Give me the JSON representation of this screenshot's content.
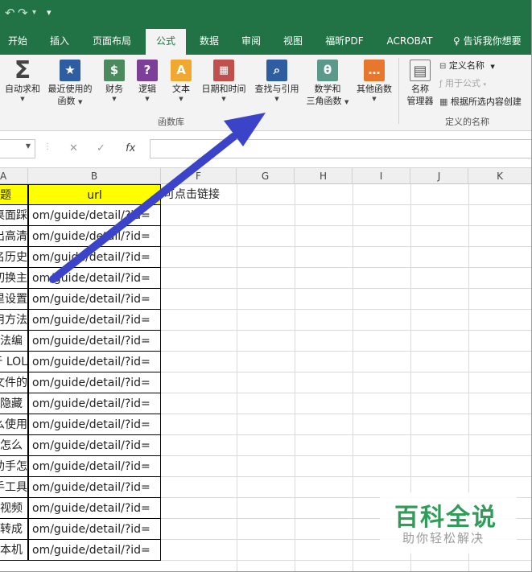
{
  "colors": {
    "excel_green": "#217346",
    "header_fill": "#ffff00",
    "arrow": "#3b44c8",
    "watermark_green": "#2f9d58",
    "watermark_gray": "#9a9a9a"
  },
  "qat": {
    "redo_glyph": "↷",
    "customize_glyph": "▾"
  },
  "tabs": [
    {
      "label": "开始"
    },
    {
      "label": "插入"
    },
    {
      "label": "页面布局"
    },
    {
      "label": "公式",
      "active": true
    },
    {
      "label": "数据"
    },
    {
      "label": "审阅"
    },
    {
      "label": "视图"
    },
    {
      "label": "福昕PDF"
    },
    {
      "label": "ACROBAT"
    }
  ],
  "tell_me": {
    "icon": "lightbulb-icon",
    "text": "告诉我你想要"
  },
  "ribbon": {
    "function_library": {
      "group_label": "函数库",
      "buttons": [
        {
          "label": "自动求和",
          "label2": "",
          "icon": "sigma-icon",
          "glyph": "Σ",
          "color": "#444444"
        },
        {
          "label": "最近使用的",
          "label2": "函数",
          "icon": "star-book-icon",
          "glyph": "★",
          "color": "#2e5e9f"
        },
        {
          "label": "财务",
          "label2": "",
          "icon": "finance-book-icon",
          "glyph": "$",
          "color": "#4b8a5c"
        },
        {
          "label": "逻辑",
          "label2": "",
          "icon": "logic-book-icon",
          "glyph": "?",
          "color": "#7d3f98"
        },
        {
          "label": "文本",
          "label2": "",
          "icon": "text-book-icon",
          "glyph": "A",
          "color": "#f0a830"
        },
        {
          "label": "日期和时间",
          "label2": "",
          "icon": "datetime-book-icon",
          "glyph": "▦",
          "color": "#c0504d"
        },
        {
          "label": "查找与引用",
          "label2": "",
          "icon": "lookup-book-icon",
          "glyph": "⌕",
          "color": "#2e5e9f"
        },
        {
          "label": "数学和",
          "label2": "三角函数",
          "icon": "math-book-icon",
          "glyph": "θ",
          "color": "#5b9a8b"
        },
        {
          "label": "其他函数",
          "label2": "",
          "icon": "more-functions-icon",
          "glyph": "…",
          "color": "#e8772e"
        }
      ]
    },
    "defined_names": {
      "group_label": "定义的名称",
      "name_manager_1": "名称",
      "name_manager_2": "管理器",
      "define_name": "定义名称",
      "use_in_formula": "用于公式",
      "create_from_selection": "根据所选内容创建"
    }
  },
  "formula_bar": {
    "cancel_glyph": "✕",
    "enter_glyph": "✓",
    "fx_label": "fx",
    "value": ""
  },
  "sheet": {
    "columns": [
      "A",
      "B",
      "F",
      "G",
      "H",
      "I",
      "J",
      "K"
    ],
    "header_row": {
      "a": "题",
      "b": "url"
    },
    "f1_note": "可点击链接",
    "rows": [
      {
        "a": "桌面踩",
        "b": "om/guide/detail/?id="
      },
      {
        "a": "出高清",
        "b": "om/guide/detail/?id="
      },
      {
        "a": "名历史",
        "b": "om/guide/detail/?id="
      },
      {
        "a": "切换主",
        "b": "om/guide/detail/?id="
      },
      {
        "a": "里设置",
        "b": "om/guide/detail/?id="
      },
      {
        "a": "用方法",
        "b": "om/guide/detail/?id="
      },
      {
        "a": "法编",
        "b": "om/guide/detail/?id="
      },
      {
        "a": "于 LOL",
        "b": "om/guide/detail/?id="
      },
      {
        "a": "文件的",
        "b": "om/guide/detail/?id="
      },
      {
        "a": "隐藏",
        "b": "om/guide/detail/?id="
      },
      {
        "a": "么使用",
        "b": "om/guide/detail/?id="
      },
      {
        "a": "怎么",
        "b": "om/guide/detail/?id="
      },
      {
        "a": "助手怎",
        "b": "om/guide/detail/?id="
      },
      {
        "a": "手工具",
        "b": "om/guide/detail/?id="
      },
      {
        "a": "视频",
        "b": "om/guide/detail/?id="
      },
      {
        "a": "转成",
        "b": "om/guide/detail/?id="
      },
      {
        "a": "本机",
        "b": "om/guide/detail/?id="
      }
    ]
  },
  "watermark": {
    "title": "百科全说",
    "subtitle": "助你轻松解决"
  }
}
